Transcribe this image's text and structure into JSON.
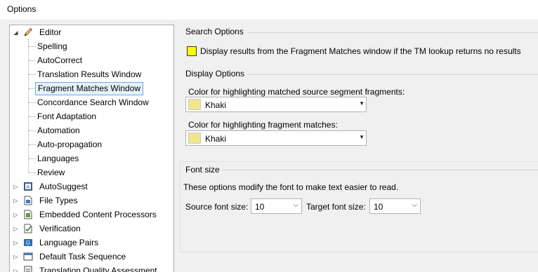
{
  "window": {
    "title": "Options"
  },
  "tree": {
    "editor": {
      "label": "Editor",
      "expander": "◢"
    },
    "editor_children": [
      "Spelling",
      "AutoCorrect",
      "Translation Results Window",
      "Fragment Matches Window",
      "Concordance Search Window",
      "Font Adaptation",
      "Automation",
      "Auto-propagation",
      "Languages",
      "Review"
    ],
    "selected": "Fragment Matches Window",
    "collapsed": [
      {
        "label": "AutoSuggest",
        "icon": "autosuggest-icon"
      },
      {
        "label": "File Types",
        "icon": "file-types-icon"
      },
      {
        "label": "Embedded Content Processors",
        "icon": "embedded-content-icon"
      },
      {
        "label": "Verification",
        "icon": "verification-icon"
      },
      {
        "label": "Language Pairs",
        "icon": "language-pairs-icon"
      },
      {
        "label": "Default Task Sequence",
        "icon": "task-sequence-icon"
      },
      {
        "label": "Translation Quality Assessment",
        "icon": "tqa-icon"
      }
    ]
  },
  "search_options": {
    "title": "Search Options",
    "checkbox_label": "Display results from the Fragment Matches window if the TM lookup returns no results",
    "checkbox_color": "#ffff00"
  },
  "display_options": {
    "title": "Display Options",
    "source_label": "Color for highlighting matched source segment fragments:",
    "source_value": "Khaki",
    "fragment_label": "Color for highlighting fragment matches:",
    "fragment_value": "Khaki",
    "khaki_color": "#f0e68c"
  },
  "font_size": {
    "title": "Font size",
    "description": "These options modify the font to make text easier to read.",
    "source_label": "Source font size:",
    "source_value": "10",
    "target_label": "Target font size:",
    "target_value": "10"
  }
}
